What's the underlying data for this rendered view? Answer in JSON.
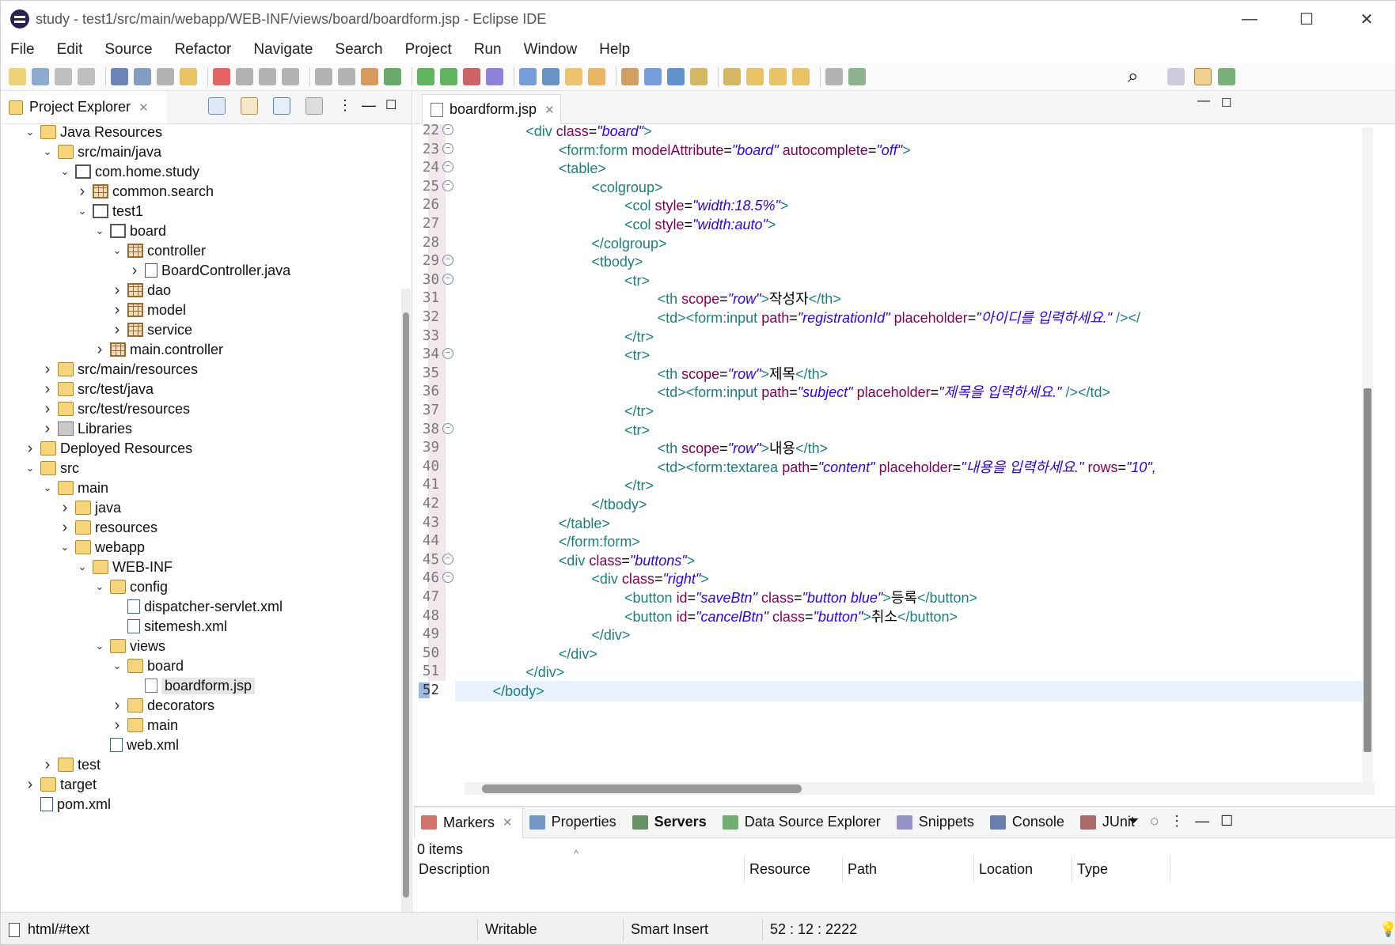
{
  "window": {
    "title": "study - test1/src/main/webapp/WEB-INF/views/board/boardform.jsp - Eclipse IDE",
    "minimize": "—",
    "maximize": "☐",
    "close": "✕"
  },
  "menu": [
    "File",
    "Edit",
    "Source",
    "Refactor",
    "Navigate",
    "Search",
    "Project",
    "Run",
    "Window",
    "Help"
  ],
  "explorer": {
    "tab_label": "Project Explorer",
    "close": "✕",
    "items": [
      {
        "label": "Java Resources",
        "depth": 1,
        "twisty": "v",
        "icon": "srcf"
      },
      {
        "label": "src/main/java",
        "depth": 2,
        "twisty": "v",
        "icon": "srcf"
      },
      {
        "label": "com.home.study",
        "depth": 3,
        "twisty": "v",
        "icon": "pkgg"
      },
      {
        "label": "common.search",
        "depth": 4,
        "twisty": ">",
        "icon": "pkg"
      },
      {
        "label": "test1",
        "depth": 4,
        "twisty": "v",
        "icon": "pkgg"
      },
      {
        "label": "board",
        "depth": 5,
        "twisty": "v",
        "icon": "pkgg"
      },
      {
        "label": "controller",
        "depth": 6,
        "twisty": "v",
        "icon": "pkg"
      },
      {
        "label": "BoardController.java",
        "depth": 7,
        "twisty": ">",
        "icon": "java"
      },
      {
        "label": "dao",
        "depth": 6,
        "twisty": ">",
        "icon": "pkg"
      },
      {
        "label": "model",
        "depth": 6,
        "twisty": ">",
        "icon": "pkg"
      },
      {
        "label": "service",
        "depth": 6,
        "twisty": ">",
        "icon": "pkg"
      },
      {
        "label": "main.controller",
        "depth": 5,
        "twisty": ">",
        "icon": "pkg"
      },
      {
        "label": "src/main/resources",
        "depth": 2,
        "twisty": ">",
        "icon": "srcf"
      },
      {
        "label": "src/test/java",
        "depth": 2,
        "twisty": ">",
        "icon": "srcf"
      },
      {
        "label": "src/test/resources",
        "depth": 2,
        "twisty": ">",
        "icon": "srcf"
      },
      {
        "label": "Libraries",
        "depth": 2,
        "twisty": ">",
        "icon": "lib"
      },
      {
        "label": "Deployed Resources",
        "depth": 1,
        "twisty": ">",
        "icon": "folder"
      },
      {
        "label": "src",
        "depth": 1,
        "twisty": "v",
        "icon": "folder"
      },
      {
        "label": "main",
        "depth": 2,
        "twisty": "v",
        "icon": "folder"
      },
      {
        "label": "java",
        "depth": 3,
        "twisty": ">",
        "icon": "folder"
      },
      {
        "label": "resources",
        "depth": 3,
        "twisty": ">",
        "icon": "folder"
      },
      {
        "label": "webapp",
        "depth": 3,
        "twisty": "v",
        "icon": "folder"
      },
      {
        "label": "WEB-INF",
        "depth": 4,
        "twisty": "v",
        "icon": "folder"
      },
      {
        "label": "config",
        "depth": 5,
        "twisty": "v",
        "icon": "folder"
      },
      {
        "label": "dispatcher-servlet.xml",
        "depth": 6,
        "twisty": "",
        "icon": "xml"
      },
      {
        "label": "sitemesh.xml",
        "depth": 6,
        "twisty": "",
        "icon": "xml"
      },
      {
        "label": "views",
        "depth": 5,
        "twisty": "v",
        "icon": "folder"
      },
      {
        "label": "board",
        "depth": 6,
        "twisty": "v",
        "icon": "folder"
      },
      {
        "label": "boardform.jsp",
        "depth": 7,
        "twisty": "",
        "icon": "jsp",
        "selected": true
      },
      {
        "label": "decorators",
        "depth": 6,
        "twisty": ">",
        "icon": "folder"
      },
      {
        "label": "main",
        "depth": 6,
        "twisty": ">",
        "icon": "folder"
      },
      {
        "label": "web.xml",
        "depth": 5,
        "twisty": "",
        "icon": "xml"
      },
      {
        "label": "test",
        "depth": 2,
        "twisty": ">",
        "icon": "folder"
      },
      {
        "label": "target",
        "depth": 1,
        "twisty": ">",
        "icon": "folder"
      },
      {
        "label": "pom.xml",
        "depth": 1,
        "twisty": "",
        "icon": "mvn"
      }
    ]
  },
  "editor": {
    "tab_label": "boardform.jsp",
    "close": "✕",
    "lines": [
      {
        "n": "22",
        "fold": true,
        "i": 2,
        "t": [
          [
            "tg",
            "<div "
          ],
          [
            "at",
            "class"
          ],
          [
            "tx",
            "="
          ],
          [
            "vl",
            "\"board\""
          ],
          [
            "tg",
            ">"
          ]
        ]
      },
      {
        "n": "23",
        "fold": true,
        "i": 3,
        "t": [
          [
            "tg",
            "<form:form "
          ],
          [
            "at",
            "modelAttribute"
          ],
          [
            "tx",
            "="
          ],
          [
            "vl",
            "\"board\""
          ],
          [
            "tx",
            " "
          ],
          [
            "at",
            "autocomplete"
          ],
          [
            "tx",
            "="
          ],
          [
            "vl",
            "\"off\""
          ],
          [
            "tg",
            ">"
          ]
        ]
      },
      {
        "n": "24",
        "fold": true,
        "i": 3,
        "t": [
          [
            "tg",
            "<table>"
          ]
        ]
      },
      {
        "n": "25",
        "fold": true,
        "i": 4,
        "t": [
          [
            "tg",
            "<colgroup>"
          ]
        ]
      },
      {
        "n": "26",
        "fold": false,
        "i": 5,
        "t": [
          [
            "tg",
            "<col "
          ],
          [
            "at",
            "style"
          ],
          [
            "tx",
            "="
          ],
          [
            "vl",
            "\"width:18.5%\""
          ],
          [
            "tg",
            ">"
          ]
        ]
      },
      {
        "n": "27",
        "fold": false,
        "i": 5,
        "t": [
          [
            "tg",
            "<col "
          ],
          [
            "at",
            "style"
          ],
          [
            "tx",
            "="
          ],
          [
            "vl",
            "\"width:auto\""
          ],
          [
            "tg",
            ">"
          ]
        ]
      },
      {
        "n": "28",
        "fold": false,
        "i": 4,
        "t": [
          [
            "tg",
            "</colgroup>"
          ]
        ]
      },
      {
        "n": "29",
        "fold": true,
        "i": 4,
        "t": [
          [
            "tg",
            "<tbody>"
          ]
        ]
      },
      {
        "n": "30",
        "fold": true,
        "i": 5,
        "t": [
          [
            "tg",
            "<tr>"
          ]
        ]
      },
      {
        "n": "31",
        "fold": false,
        "i": 6,
        "t": [
          [
            "tg",
            "<th "
          ],
          [
            "at",
            "scope"
          ],
          [
            "tx",
            "="
          ],
          [
            "vl",
            "\"row\""
          ],
          [
            "tg",
            ">"
          ],
          [
            "tx",
            "작성자"
          ],
          [
            "tg",
            "</th>"
          ]
        ]
      },
      {
        "n": "32",
        "fold": false,
        "i": 6,
        "t": [
          [
            "tg",
            "<td><form:input "
          ],
          [
            "at",
            "path"
          ],
          [
            "tx",
            "="
          ],
          [
            "vl",
            "\"registrationId\""
          ],
          [
            "tx",
            " "
          ],
          [
            "at",
            "placeholder"
          ],
          [
            "tx",
            "="
          ],
          [
            "vl",
            "\"아이디를 입력하세요.\""
          ],
          [
            "tg",
            " /></"
          ]
        ]
      },
      {
        "n": "33",
        "fold": false,
        "i": 5,
        "t": [
          [
            "tg",
            "</tr>"
          ]
        ]
      },
      {
        "n": "34",
        "fold": true,
        "i": 5,
        "t": [
          [
            "tg",
            "<tr>"
          ]
        ]
      },
      {
        "n": "35",
        "fold": false,
        "i": 6,
        "t": [
          [
            "tg",
            "<th "
          ],
          [
            "at",
            "scope"
          ],
          [
            "tx",
            "="
          ],
          [
            "vl",
            "\"row\""
          ],
          [
            "tg",
            ">"
          ],
          [
            "tx",
            "제목"
          ],
          [
            "tg",
            "</th>"
          ]
        ]
      },
      {
        "n": "36",
        "fold": false,
        "i": 6,
        "t": [
          [
            "tg",
            "<td><form:input "
          ],
          [
            "at",
            "path"
          ],
          [
            "tx",
            "="
          ],
          [
            "vl",
            "\"subject\""
          ],
          [
            "tx",
            " "
          ],
          [
            "at",
            "placeholder"
          ],
          [
            "tx",
            "="
          ],
          [
            "vl",
            "\"제목을 입력하세요.\""
          ],
          [
            "tg",
            " /></td>"
          ]
        ]
      },
      {
        "n": "37",
        "fold": false,
        "i": 5,
        "t": [
          [
            "tg",
            "</tr>"
          ]
        ]
      },
      {
        "n": "38",
        "fold": true,
        "i": 5,
        "t": [
          [
            "tg",
            "<tr>"
          ]
        ]
      },
      {
        "n": "39",
        "fold": false,
        "i": 6,
        "t": [
          [
            "tg",
            "<th "
          ],
          [
            "at",
            "scope"
          ],
          [
            "tx",
            "="
          ],
          [
            "vl",
            "\"row\""
          ],
          [
            "tg",
            ">"
          ],
          [
            "tx",
            "내용"
          ],
          [
            "tg",
            "</th>"
          ]
        ]
      },
      {
        "n": "40",
        "fold": false,
        "i": 6,
        "t": [
          [
            "tg",
            "<td><form:textarea "
          ],
          [
            "at",
            "path"
          ],
          [
            "tx",
            "="
          ],
          [
            "vl",
            "\"content\""
          ],
          [
            "tx",
            " "
          ],
          [
            "at",
            "placeholder"
          ],
          [
            "tx",
            "="
          ],
          [
            "vl",
            "\"내용을 입력하세요.\""
          ],
          [
            "tx",
            " "
          ],
          [
            "at",
            "rows"
          ],
          [
            "tx",
            "="
          ],
          [
            "vl",
            "\"10\","
          ]
        ]
      },
      {
        "n": "41",
        "fold": false,
        "i": 5,
        "t": [
          [
            "tg",
            "</tr>"
          ]
        ]
      },
      {
        "n": "42",
        "fold": false,
        "i": 4,
        "t": [
          [
            "tg",
            "</tbody>"
          ]
        ]
      },
      {
        "n": "43",
        "fold": false,
        "i": 3,
        "t": [
          [
            "tg",
            "</table>"
          ]
        ]
      },
      {
        "n": "44",
        "fold": false,
        "i": 3,
        "t": [
          [
            "tg",
            "</form:form>"
          ]
        ]
      },
      {
        "n": "45",
        "fold": true,
        "i": 3,
        "t": [
          [
            "tg",
            "<div "
          ],
          [
            "at",
            "class"
          ],
          [
            "tx",
            "="
          ],
          [
            "vl",
            "\"buttons\""
          ],
          [
            "tg",
            ">"
          ]
        ]
      },
      {
        "n": "46",
        "fold": true,
        "i": 4,
        "t": [
          [
            "tg",
            "<div "
          ],
          [
            "at",
            "class"
          ],
          [
            "tx",
            "="
          ],
          [
            "vl",
            "\"right\""
          ],
          [
            "tg",
            ">"
          ]
        ]
      },
      {
        "n": "47",
        "fold": false,
        "i": 5,
        "t": [
          [
            "tg",
            "<button "
          ],
          [
            "at",
            "id"
          ],
          [
            "tx",
            "="
          ],
          [
            "vl",
            "\"saveBtn\""
          ],
          [
            "tx",
            " "
          ],
          [
            "at",
            "class"
          ],
          [
            "tx",
            "="
          ],
          [
            "vl",
            "\"button blue\""
          ],
          [
            "tg",
            ">"
          ],
          [
            "tx",
            "등록"
          ],
          [
            "tg",
            "</button>"
          ]
        ]
      },
      {
        "n": "48",
        "fold": false,
        "i": 5,
        "t": [
          [
            "tg",
            "<button "
          ],
          [
            "at",
            "id"
          ],
          [
            "tx",
            "="
          ],
          [
            "vl",
            "\"cancelBtn\""
          ],
          [
            "tx",
            " "
          ],
          [
            "at",
            "class"
          ],
          [
            "tx",
            "="
          ],
          [
            "vl",
            "\"button\""
          ],
          [
            "tg",
            ">"
          ],
          [
            "tx",
            "취소"
          ],
          [
            "tg",
            "</button>"
          ]
        ]
      },
      {
        "n": "49",
        "fold": false,
        "i": 4,
        "t": [
          [
            "tg",
            "</div>"
          ]
        ]
      },
      {
        "n": "50",
        "fold": false,
        "i": 3,
        "t": [
          [
            "tg",
            "</div>"
          ]
        ]
      },
      {
        "n": "51",
        "fold": false,
        "i": 2,
        "t": [
          [
            "tg",
            "</div>"
          ]
        ]
      },
      {
        "n": "52",
        "fold": false,
        "i": 1,
        "t": [
          [
            "tg",
            "</body>"
          ]
        ],
        "current": true
      }
    ]
  },
  "bottom": {
    "tabs": [
      {
        "label": "Markers",
        "active": true,
        "close": "✕",
        "color": "#c0392b"
      },
      {
        "label": "Properties",
        "color": "#3b6fb6"
      },
      {
        "label": "Servers",
        "bold": true,
        "color": "#2a6b2a"
      },
      {
        "label": "Data Source Explorer",
        "color": "#3b8f3b"
      },
      {
        "label": "Snippets",
        "color": "#6b6bb6"
      },
      {
        "label": "Console",
        "color": "#2d4f8f"
      },
      {
        "label": "JUnit",
        "color": "#8a2f2f"
      }
    ],
    "count": "0 items",
    "columns": [
      "Description",
      "Resource",
      "Path",
      "Location",
      "Type"
    ]
  },
  "status": {
    "path": "html/#text",
    "mode": "Writable",
    "insert": "Smart Insert",
    "position": "52 : 12 : 2222"
  }
}
